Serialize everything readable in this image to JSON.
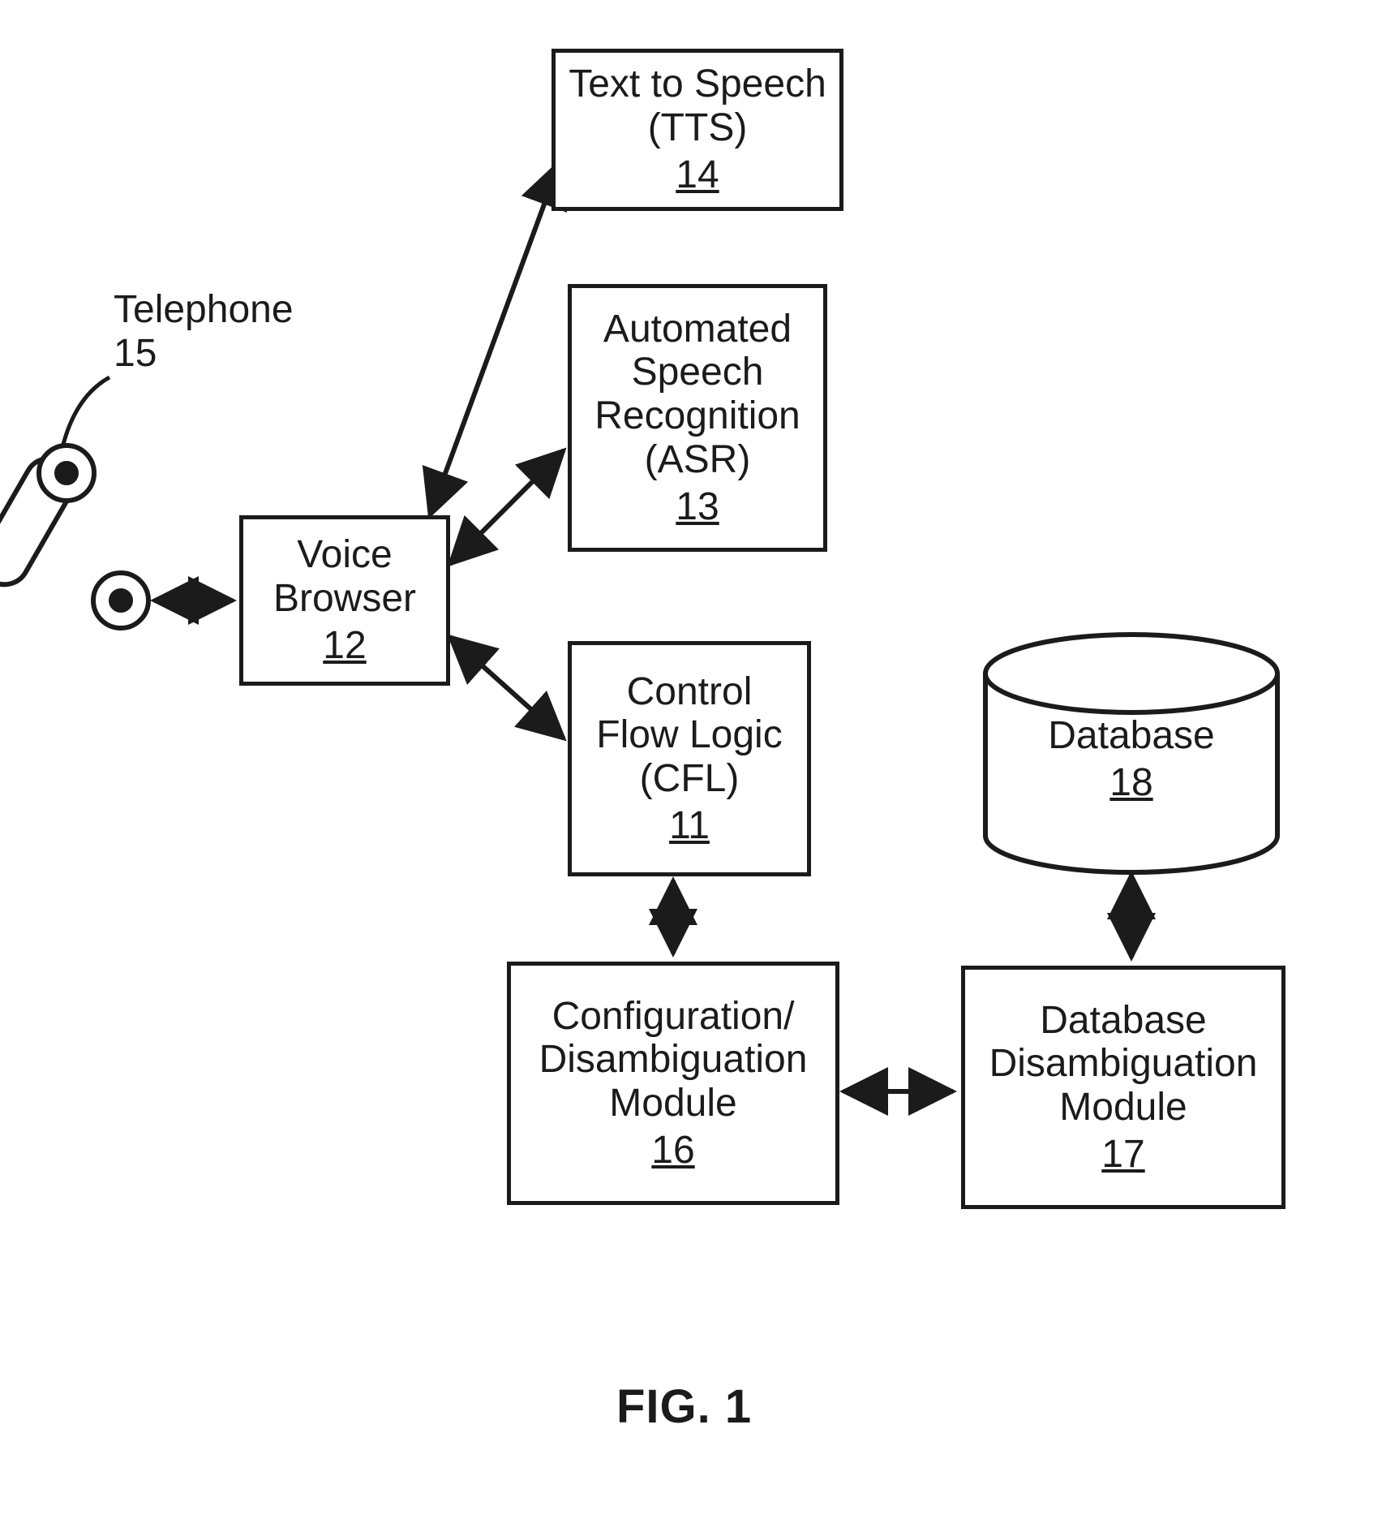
{
  "caption": "FIG. 1",
  "telephone": {
    "label": "Telephone",
    "num": "15"
  },
  "boxes": {
    "voice_browser": {
      "line1": "Voice",
      "line2": "Browser",
      "num": "12"
    },
    "tts": {
      "line1": "Text to Speech",
      "line2": "(TTS)",
      "num": "14"
    },
    "asr": {
      "line1": "Automated",
      "line2": "Speech",
      "line3": "Recognition",
      "line4": "(ASR)",
      "num": "13"
    },
    "cfl": {
      "line1": "Control",
      "line2": "Flow Logic",
      "line3": "(CFL)",
      "num": "11"
    },
    "cfg": {
      "line1": "Configuration/",
      "line2": "Disambiguation",
      "line3": "Module",
      "num": "16"
    },
    "ddm": {
      "line1": "Database",
      "line2": "Disambiguation",
      "line3": "Module",
      "num": "17"
    },
    "db": {
      "line1": "Database",
      "num": "18"
    }
  },
  "connections": [
    {
      "from": "telephone",
      "to": "voice_browser",
      "dir": "both"
    },
    {
      "from": "voice_browser",
      "to": "tts",
      "dir": "both"
    },
    {
      "from": "voice_browser",
      "to": "asr",
      "dir": "both"
    },
    {
      "from": "voice_browser",
      "to": "cfl",
      "dir": "both"
    },
    {
      "from": "cfl",
      "to": "cfg",
      "dir": "both"
    },
    {
      "from": "cfg",
      "to": "ddm",
      "dir": "both"
    },
    {
      "from": "ddm",
      "to": "db",
      "dir": "both"
    }
  ]
}
